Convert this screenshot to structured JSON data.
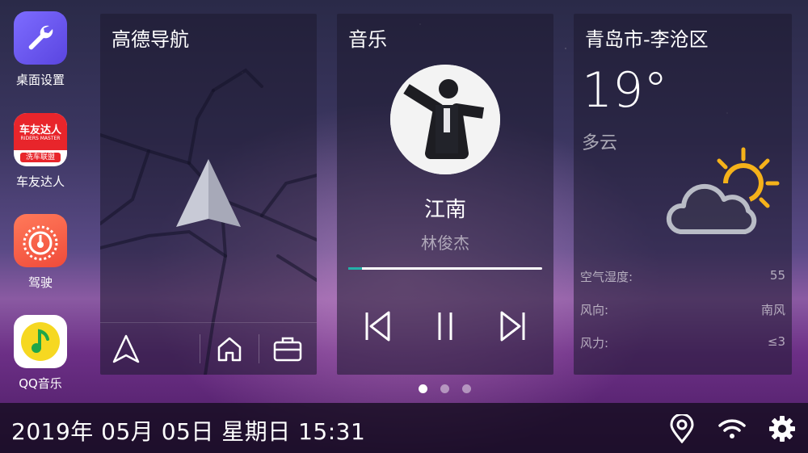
{
  "dock": {
    "apps": [
      {
        "label": "桌面设置",
        "icon": "wrench-icon"
      },
      {
        "label": "车友达人",
        "icon": "cheyou-logo-icon",
        "logo_text": "车友达人",
        "logo_subtext": "RIDERS MASTER",
        "logo_banner": "洗车联盟"
      },
      {
        "label": "驾驶",
        "icon": "speedometer-icon"
      },
      {
        "label": "QQ音乐",
        "icon": "music-note-icon"
      }
    ]
  },
  "navigation": {
    "title": "高德导航",
    "buttons": [
      "navigate-arrow-icon",
      "home-icon",
      "briefcase-icon"
    ]
  },
  "music": {
    "title": "音乐",
    "song": "江南",
    "artist": "林俊杰",
    "progress": 0.07,
    "controls": [
      "previous-icon",
      "pause-icon",
      "next-icon"
    ],
    "accent": "#24b1a9"
  },
  "weather": {
    "city": "青岛市-李沧区",
    "temperature": "19°",
    "condition": "多云",
    "rows": [
      {
        "label": "空气湿度:",
        "value": "55"
      },
      {
        "label": "风向:",
        "value": "南风"
      },
      {
        "label": "风力:",
        "value": "≤3"
      }
    ],
    "sun_color": "#f5b21a"
  },
  "pager": {
    "count": 3,
    "active": 0
  },
  "status_bar": {
    "datetime": "2019年 05月 05日 星期日 15:31",
    "icons": [
      "location-pin-icon",
      "wifi-icon",
      "settings-gear-icon"
    ]
  }
}
